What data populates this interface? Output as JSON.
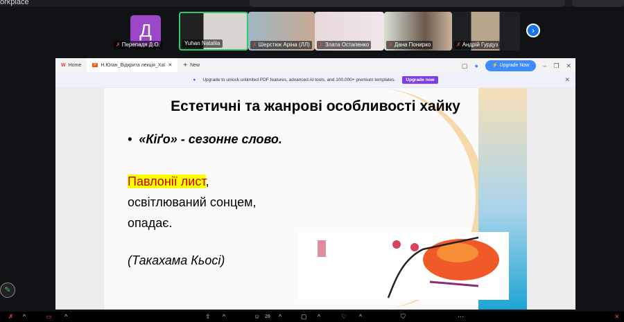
{
  "app_title": "orkplace",
  "participants": [
    {
      "name": "Перепадя Д.О.",
      "initial": "Д",
      "muted": true
    },
    {
      "name": "Yuhan Nataliia",
      "muted": false,
      "active": true
    },
    {
      "name": "Шерстюк Аріна (ЛЛ)",
      "muted": true
    },
    {
      "name": "Злата Остапенко",
      "muted": true
    },
    {
      "name": "Дана Понирко",
      "muted": true
    },
    {
      "name": "Андрій Гурдуз",
      "muted": true
    }
  ],
  "browser": {
    "tabs": [
      {
        "label": "Home"
      },
      {
        "label": "Н.Юган_Відкрита лекція_Хаї"
      },
      {
        "label": "New"
      }
    ],
    "upgrade_now": "Upgrade Now",
    "banner_text": "Upgrade to unlock unlimited PDF features, advanced AI tools, and 100,000+ premium templates.",
    "banner_button": "Upgrade now"
  },
  "slide": {
    "title": "Естетичні та жанрові особливості хайку",
    "bullet": "«Кіґо» - сезонне слово.",
    "poem_highlight": "Павлонії лист",
    "poem_line1_rest": ",",
    "poem_line2": "освітлюваний сонцем,",
    "poem_line3": "опадає.",
    "author": "(Такахама Кьосі)"
  },
  "toolbar": {
    "participants_count": "28"
  },
  "colors": {
    "accent": "#2ecc71",
    "highlight": "#ffff00",
    "highlight_text": "#c00000"
  }
}
